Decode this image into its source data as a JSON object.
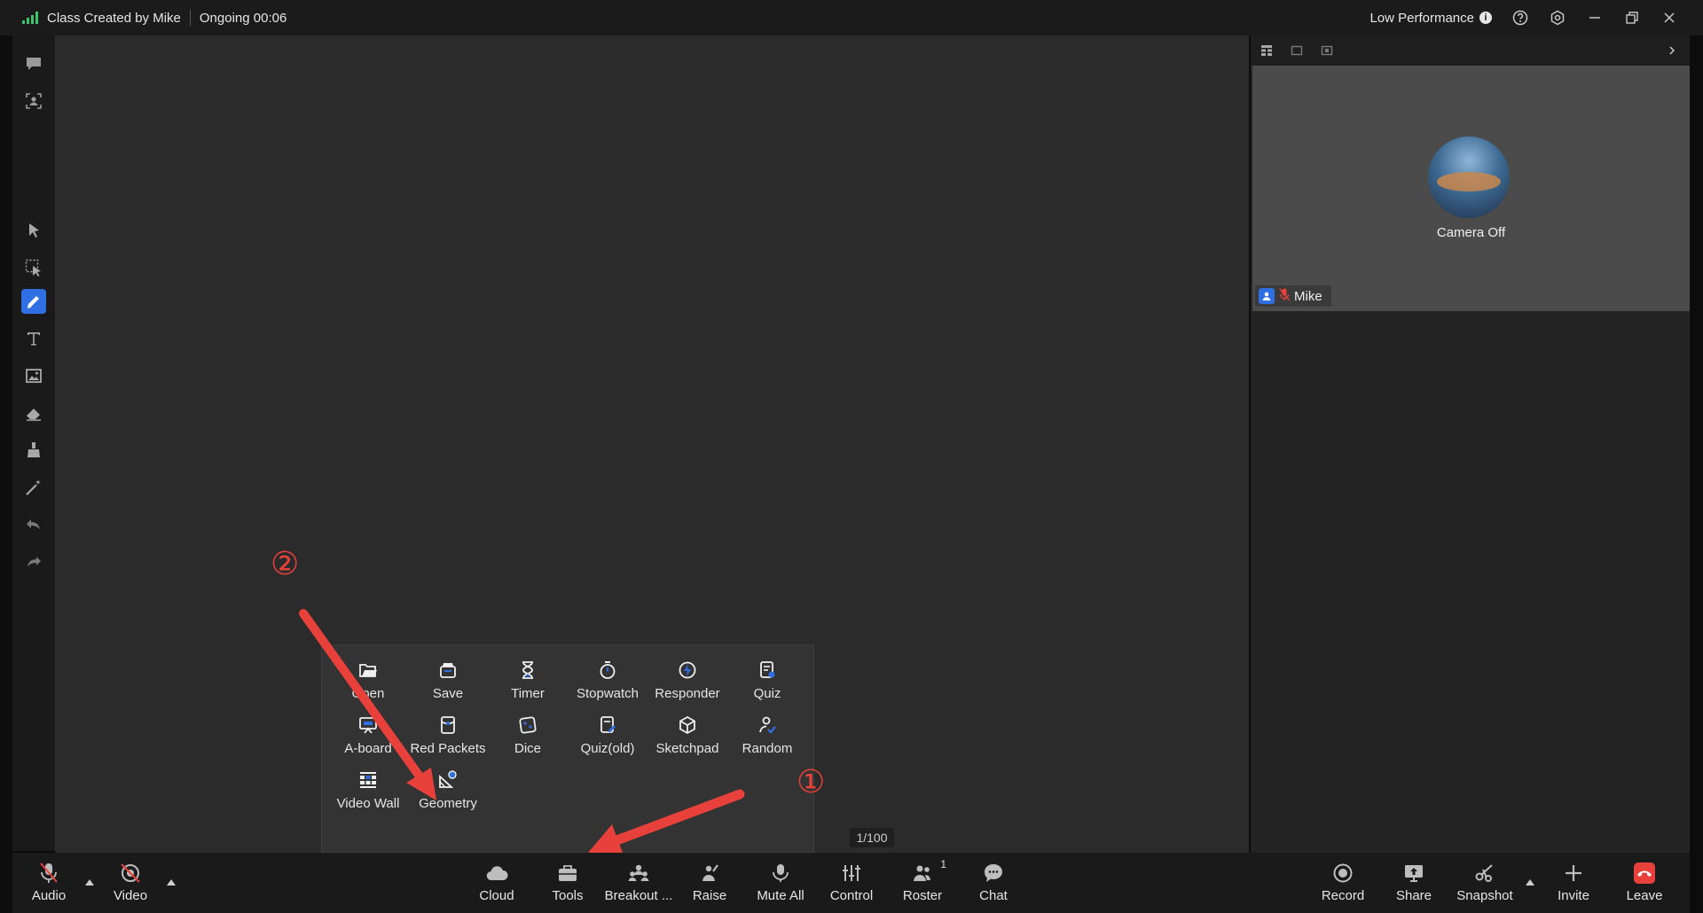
{
  "titlebar": {
    "class_title": "Class Created by Mike",
    "status": "Ongoing 00:06",
    "performance": "Low Performance",
    "info_glyph": "i"
  },
  "right_panel": {
    "camera_status": "Camera Off",
    "participant_name": "Mike"
  },
  "tools_popup": {
    "items": [
      {
        "label": "Open",
        "icon": "folder-open-icon"
      },
      {
        "label": "Save",
        "icon": "save-icon"
      },
      {
        "label": "Timer",
        "icon": "hourglass-icon"
      },
      {
        "label": "Stopwatch",
        "icon": "stopwatch-icon"
      },
      {
        "label": "Responder",
        "icon": "responder-icon"
      },
      {
        "label": "Quiz",
        "icon": "quiz-icon"
      },
      {
        "label": "A-board",
        "icon": "a-board-icon"
      },
      {
        "label": "Red Packets",
        "icon": "red-packets-icon"
      },
      {
        "label": "Dice",
        "icon": "dice-icon"
      },
      {
        "label": "Quiz(old)",
        "icon": "quiz-old-icon"
      },
      {
        "label": "Sketchpad",
        "icon": "sketchpad-icon"
      },
      {
        "label": "Random",
        "icon": "random-icon"
      },
      {
        "label": "Video Wall",
        "icon": "video-wall-icon"
      },
      {
        "label": "Geometry",
        "icon": "geometry-icon"
      }
    ]
  },
  "page_count": "1/100",
  "bottombar": {
    "audio": "Audio",
    "video": "Video",
    "cloud": "Cloud",
    "tools": "Tools",
    "breakout": "Breakout ...",
    "raise": "Raise",
    "mute_all": "Mute All",
    "control": "Control",
    "roster": "Roster",
    "roster_count": "1",
    "chat": "Chat",
    "record": "Record",
    "share": "Share",
    "snapshot": "Snapshot",
    "invite": "Invite",
    "leave": "Leave"
  },
  "annotations": {
    "marker_1": "①",
    "marker_2": "②",
    "color": "#e8413b"
  },
  "colors": {
    "accent": "#2f6fe4",
    "signal": "#3ec46d",
    "leave": "#e8413b"
  }
}
